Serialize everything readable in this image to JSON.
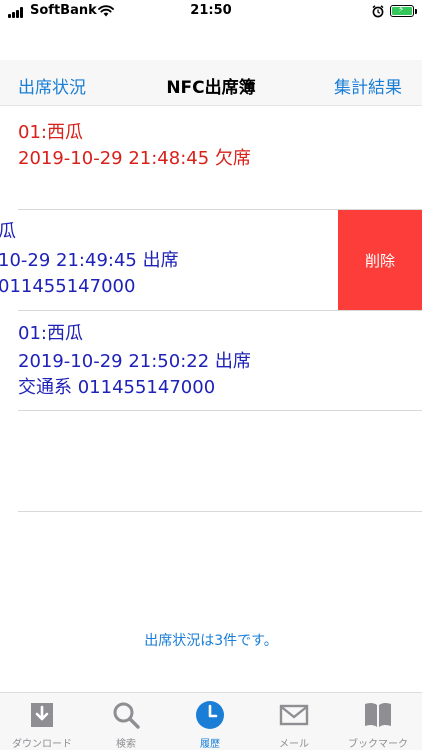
{
  "status_bar": {
    "carrier": "SoftBank",
    "time": "21:50"
  },
  "nav": {
    "left": "出席状況",
    "title": "NFC出席簿",
    "right": "集計結果"
  },
  "rows": [
    {
      "line1": "01:西瓜",
      "line2": "2019-10-29 21:48:45 欠席"
    },
    {
      "line1": "瓜",
      "line2": "10-29 21:49:45 出席",
      "line3": "011455147000",
      "delete": "削除"
    },
    {
      "line1": "01:西瓜",
      "line2": "2019-10-29 21:50:22 出席",
      "line3": "交通系 011455147000"
    }
  ],
  "footer": "出席状況は3件です。",
  "tabs": [
    {
      "label": "ダウンロード",
      "icon": "download-icon"
    },
    {
      "label": "検索",
      "icon": "search-icon"
    },
    {
      "label": "履歴",
      "icon": "history-clock-icon"
    },
    {
      "label": "メール",
      "icon": "mail-icon"
    },
    {
      "label": "ブックマーク",
      "icon": "bookmarks-icon"
    }
  ],
  "colors": {
    "accent": "#1a7ed6",
    "absent_red": "#d9201a",
    "present_blue": "#1f22b8",
    "delete_red": "#fc3d39"
  }
}
